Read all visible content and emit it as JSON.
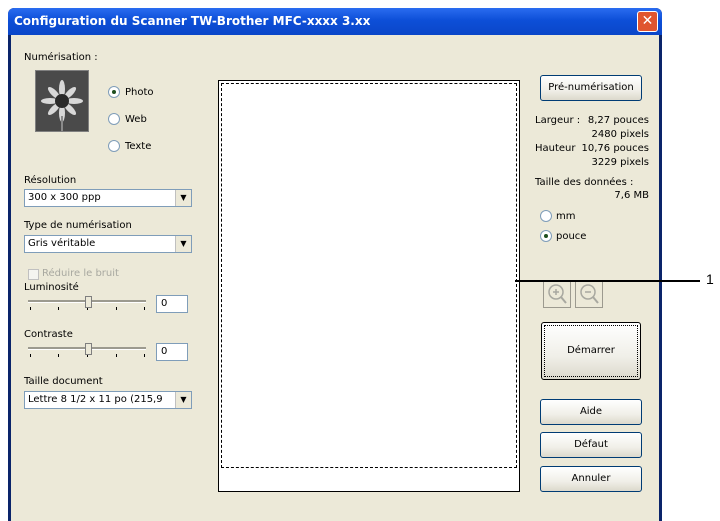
{
  "window": {
    "title": "Configuration du Scanner TW-Brother MFC-xxxx  3.xx",
    "close_label": "✕"
  },
  "scan": {
    "label": "Numérisation :",
    "options": [
      {
        "label": "Photo",
        "selected": true
      },
      {
        "label": "Web",
        "selected": false
      },
      {
        "label": "Texte",
        "selected": false
      }
    ]
  },
  "resolution": {
    "label": "Résolution",
    "value": "300 x 300 ppp"
  },
  "scan_type": {
    "label": "Type de numérisation",
    "value": "Gris véritable"
  },
  "noise": {
    "label": "Réduire le bruit",
    "checked": false,
    "enabled": false
  },
  "brightness": {
    "label": "Luminosité",
    "value": "0"
  },
  "contrast": {
    "label": "Contraste",
    "value": "0"
  },
  "doc_size": {
    "label": "Taille document",
    "value": "Lettre 8 1/2 x 11 po (215,9"
  },
  "right": {
    "prescan": "Pré-numérisation",
    "width_label": "Largeur :",
    "width_value": "8,27 pouces",
    "width_pixels": "2480 pixels",
    "height_label": "Hauteur",
    "height_value": "10,76 pouces",
    "height_pixels": "3229 pixels",
    "data_size_label": "Taille des données :",
    "data_size_value": "7,6 MB",
    "unit_mm": "mm",
    "unit_inch": "pouce",
    "selected_unit": "pouce",
    "start": "Démarrer",
    "help": "Aide",
    "default": "Défaut",
    "cancel": "Annuler"
  },
  "callout": "1",
  "colors": {
    "titlebar": "#0d4fd8",
    "dialog": "#ece9d8",
    "close": "#e0552f"
  }
}
